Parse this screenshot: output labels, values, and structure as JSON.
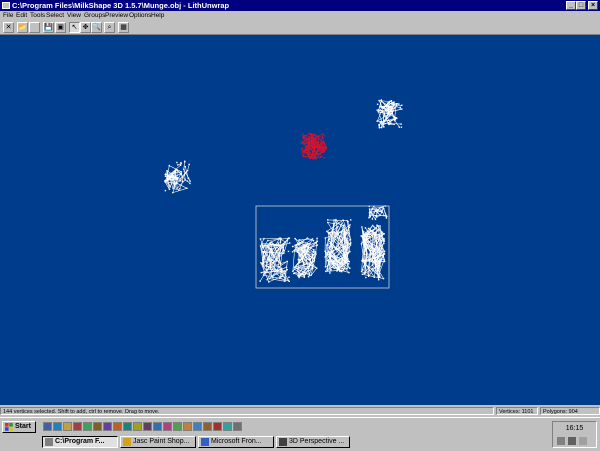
{
  "window": {
    "title": "C:\\Program Files\\MilkShape 3D 1.5.7\\Munge.obj - LithUnwrap",
    "buttons": {
      "minimize": "_",
      "maximize": "□",
      "close": "×"
    }
  },
  "menu": [
    "File",
    "Edit",
    "Tools",
    "Select",
    "View",
    "Groups",
    "Preview",
    "Options",
    "Help"
  ],
  "toolbar": [
    {
      "icon": "close-document-icon",
      "glyph": "✕"
    },
    {
      "icon": "open-folder-icon",
      "glyph": "📂"
    },
    {
      "icon": "blank-icon",
      "glyph": ""
    },
    {
      "icon": "save-icon",
      "glyph": "💾"
    },
    {
      "icon": "save-as-icon",
      "glyph": "▣"
    },
    {
      "icon": "select-arrow-icon",
      "glyph": "↖"
    },
    {
      "icon": "move-icon",
      "glyph": "✥"
    },
    {
      "icon": "zoom-icon",
      "glyph": "🔍"
    },
    {
      "icon": "zoom-fit-icon",
      "glyph": "⌕"
    },
    {
      "icon": "preview-icon",
      "glyph": "▦"
    }
  ],
  "canvas": {
    "background": "#003c8c",
    "wire_color": "#ffffff",
    "selected_color": "#e0102a"
  },
  "statusbar": {
    "message": "144 vertices selected. Shift to add, ctrl to remove. Drag to move.",
    "vertices": "Vertices: 1101",
    "polygons": "Polygons: 904"
  },
  "taskbar": {
    "start_label": "Start",
    "quick_launch": [
      "desktop-icon",
      "ie-icon",
      "outlook-icon",
      "tool-icon",
      "app-icon-1",
      "app-icon-2",
      "app-icon-3",
      "app-icon-4",
      "app-icon-5",
      "app-icon-6",
      "app-icon-7",
      "app-icon-8",
      "app-icon-9",
      "app-icon-10",
      "app-icon-11",
      "app-icon-12",
      "app-icon-13",
      "app-icon-14",
      "app-icon-15",
      "app-icon-16"
    ],
    "tasks": [
      {
        "label": "C:\\Program F...",
        "active": true
      },
      {
        "label": "Jasc Paint Shop...",
        "active": false
      },
      {
        "label": "Microsoft Fron...",
        "active": false
      },
      {
        "label": "3D Perspective ...",
        "active": false
      }
    ],
    "clock": "16:15"
  }
}
